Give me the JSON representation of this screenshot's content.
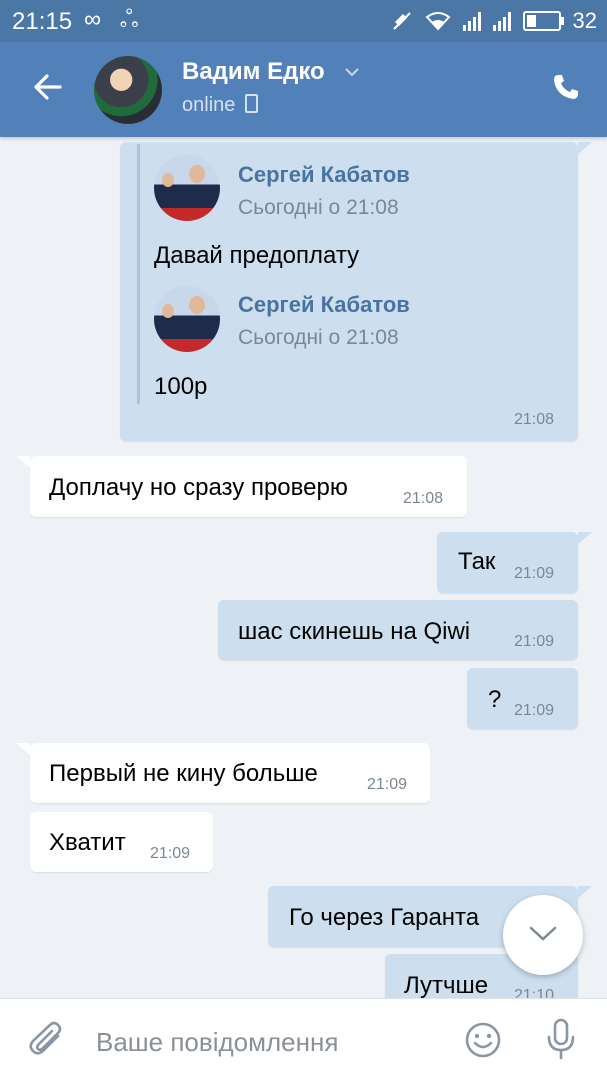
{
  "status_bar": {
    "time": "21:15",
    "battery": "32",
    "battery_level": 0.32
  },
  "header": {
    "contact_name": "Вадим Едко",
    "status": "online"
  },
  "forwarded": {
    "items": [
      {
        "author": "Сергей Кабатов",
        "date": "Сьогодні о 21:08",
        "text": "Давай предоплату"
      },
      {
        "author": "Сергей Кабатов",
        "date": "Сьогодні о 21:08",
        "text": "100р"
      }
    ],
    "time": "21:08"
  },
  "messages": [
    {
      "dir": "in",
      "text": "Доплачу но сразу проверю",
      "time": "21:08"
    },
    {
      "dir": "out",
      "text": "Так",
      "time": "21:09"
    },
    {
      "dir": "out",
      "text": "шас скинешь на Qiwi",
      "time": "21:09"
    },
    {
      "dir": "out",
      "text": "?",
      "time": "21:09"
    },
    {
      "dir": "in",
      "text": "Первый не кину больше",
      "time": "21:09"
    },
    {
      "dir": "in",
      "text": "Хватит",
      "time": "21:09"
    },
    {
      "dir": "out",
      "text": "Го через Гаранта",
      "time": ""
    },
    {
      "dir": "out",
      "text": "Лутчше",
      "time": "21:10"
    }
  ],
  "composer": {
    "placeholder": "Ваше повідомлення"
  },
  "colors": {
    "header": "#5181b8",
    "status_bar": "#4a77a5",
    "outgoing_bubble": "#cddfef",
    "incoming_bubble": "#ffffff",
    "background": "#eef1f5"
  }
}
